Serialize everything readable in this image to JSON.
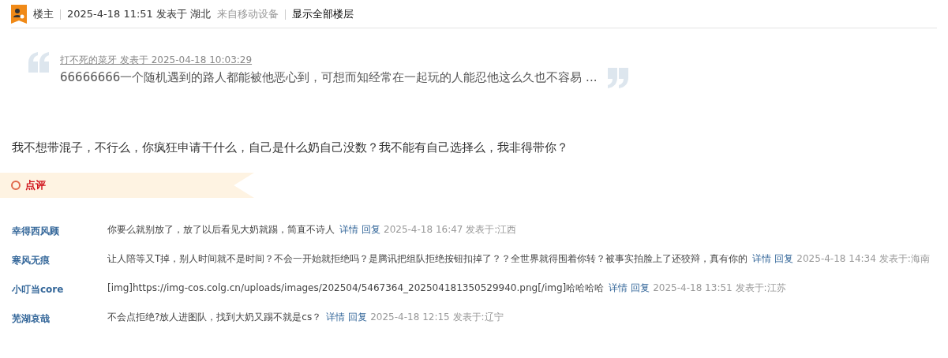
{
  "post_header": {
    "role": "楼主",
    "posted": "2025-4-18 11:51 发表于 湖北",
    "device": "来自移动设备",
    "show_all": "显示全部楼层"
  },
  "quote": {
    "author_line": "打不死的菜牙 发表于 2025-04-18 10:03:29",
    "text": "66666666一个随机遇到的路人都能被他恶心到，可想而知经常在一起玩的人能忍他这么久也不容易 ..."
  },
  "body": "我不想带混子，不行么，你疯狂申请干什么，自己是什么奶自己没数？我不能有自己选择么，我非得带你？",
  "comments_banner": "点评",
  "comments": [
    {
      "user": "幸得西风顾",
      "text": "你要么就别放了，放了以后看见大奶就踢，简直不诗人",
      "detail": "详情",
      "reply": "回复",
      "meta": "2025-4-18 16:47 发表于:江西"
    },
    {
      "user": "寒风无痕",
      "text": "让人陪等又T掉，别人时间就不是时间？不会一开始就拒绝吗？是腾讯把组队拒绝按钮扣掉了？？全世界就得围着你转？被事实拍脸上了还狡辩，真有你的",
      "detail": "详情",
      "reply": "回复",
      "meta": "2025-4-18 14:34 发表于:海南"
    },
    {
      "user": "小叮当core",
      "text": "[img]https://img-cos.colg.cn/uploads/images/202504/5467364_202504181350529940.png[/img]哈哈哈哈",
      "detail": "详情",
      "reply": "回复",
      "meta": "2025-4-18 13:51 发表于:江苏"
    },
    {
      "user": "芜湖哀哉",
      "text": "不会点拒绝?放人进图队，找到大奶又踢不就是cs？",
      "detail": "详情",
      "reply": "回复",
      "meta": "2025-4-18 12:15 发表于:辽宁"
    }
  ]
}
